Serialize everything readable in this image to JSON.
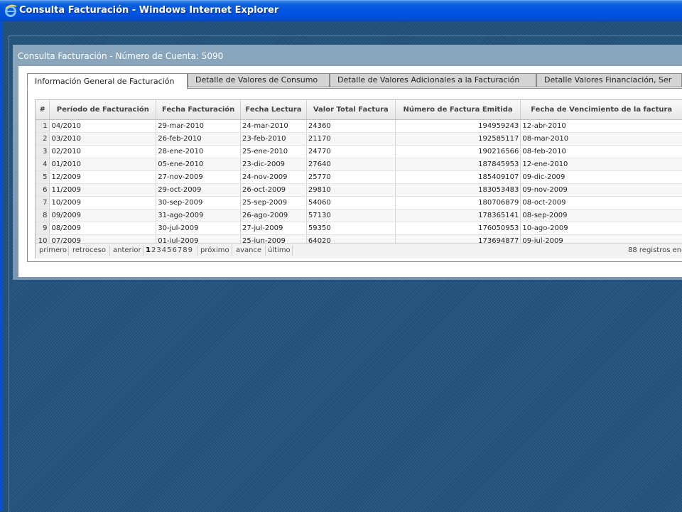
{
  "window": {
    "title": "Consulta Facturación - Windows Internet Explorer"
  },
  "dialog": {
    "title": "Consulta Facturación - Número de Cuenta: 5090"
  },
  "tabs": [
    {
      "label": "Información General de Facturación",
      "active": true
    },
    {
      "label": "Detalle de Valores de Consumo",
      "active": false
    },
    {
      "label": "Detalle de Valores Adicionales a la Facturación",
      "active": false
    },
    {
      "label": "Detalle Valores Financiación, Ser",
      "active": false
    }
  ],
  "grid": {
    "columns": [
      "#",
      "Período de Facturación",
      "Fecha Facturación",
      "Fecha Lectura",
      "Valor Total Factura",
      "Número de Factura Emitida",
      "Fecha de Vencimiento de la factura"
    ],
    "rows": [
      [
        "1",
        "04/2010",
        "29-mar-2010",
        "24-mar-2010",
        "24360",
        "194959243",
        "12-abr-2010"
      ],
      [
        "2",
        "03/2010",
        "26-feb-2010",
        "23-feb-2010",
        "21170",
        "192585117",
        "08-mar-2010"
      ],
      [
        "3",
        "02/2010",
        "28-ene-2010",
        "25-ene-2010",
        "24770",
        "190216566",
        "08-feb-2010"
      ],
      [
        "4",
        "01/2010",
        "05-ene-2010",
        "23-dic-2009",
        "27640",
        "187845953",
        "12-ene-2010"
      ],
      [
        "5",
        "12/2009",
        "27-nov-2009",
        "24-nov-2009",
        "25770",
        "185409107",
        "09-dic-2009"
      ],
      [
        "6",
        "11/2009",
        "29-oct-2009",
        "26-oct-2009",
        "29810",
        "183053483",
        "09-nov-2009"
      ],
      [
        "7",
        "10/2009",
        "30-sep-2009",
        "25-sep-2009",
        "54060",
        "180706879",
        "08-oct-2009"
      ],
      [
        "8",
        "09/2009",
        "31-ago-2009",
        "26-ago-2009",
        "57130",
        "178365141",
        "08-sep-2009"
      ],
      [
        "9",
        "08/2009",
        "30-jul-2009",
        "27-jul-2009",
        "59350",
        "176050953",
        "10-ago-2009"
      ],
      [
        "10",
        "07/2009",
        "01-jul-2009",
        "25-jun-2009",
        "64020",
        "173694877",
        "09-jul-2009"
      ]
    ]
  },
  "pager": {
    "first": "primero",
    "back": "retroceso",
    "prev": "anterior",
    "pages": [
      "1",
      "2",
      "3",
      "4",
      "5",
      "6",
      "7",
      "8",
      "9"
    ],
    "current": "1",
    "next": "próximo",
    "forward": "avance",
    "last": "último",
    "records": "88 registros enc"
  },
  "colors": {
    "titlebar": "#0054e3",
    "desktop": "#1f4d74",
    "dialog": "#8aa6bd"
  },
  "icons": {
    "window": "internet-explorer-icon"
  }
}
